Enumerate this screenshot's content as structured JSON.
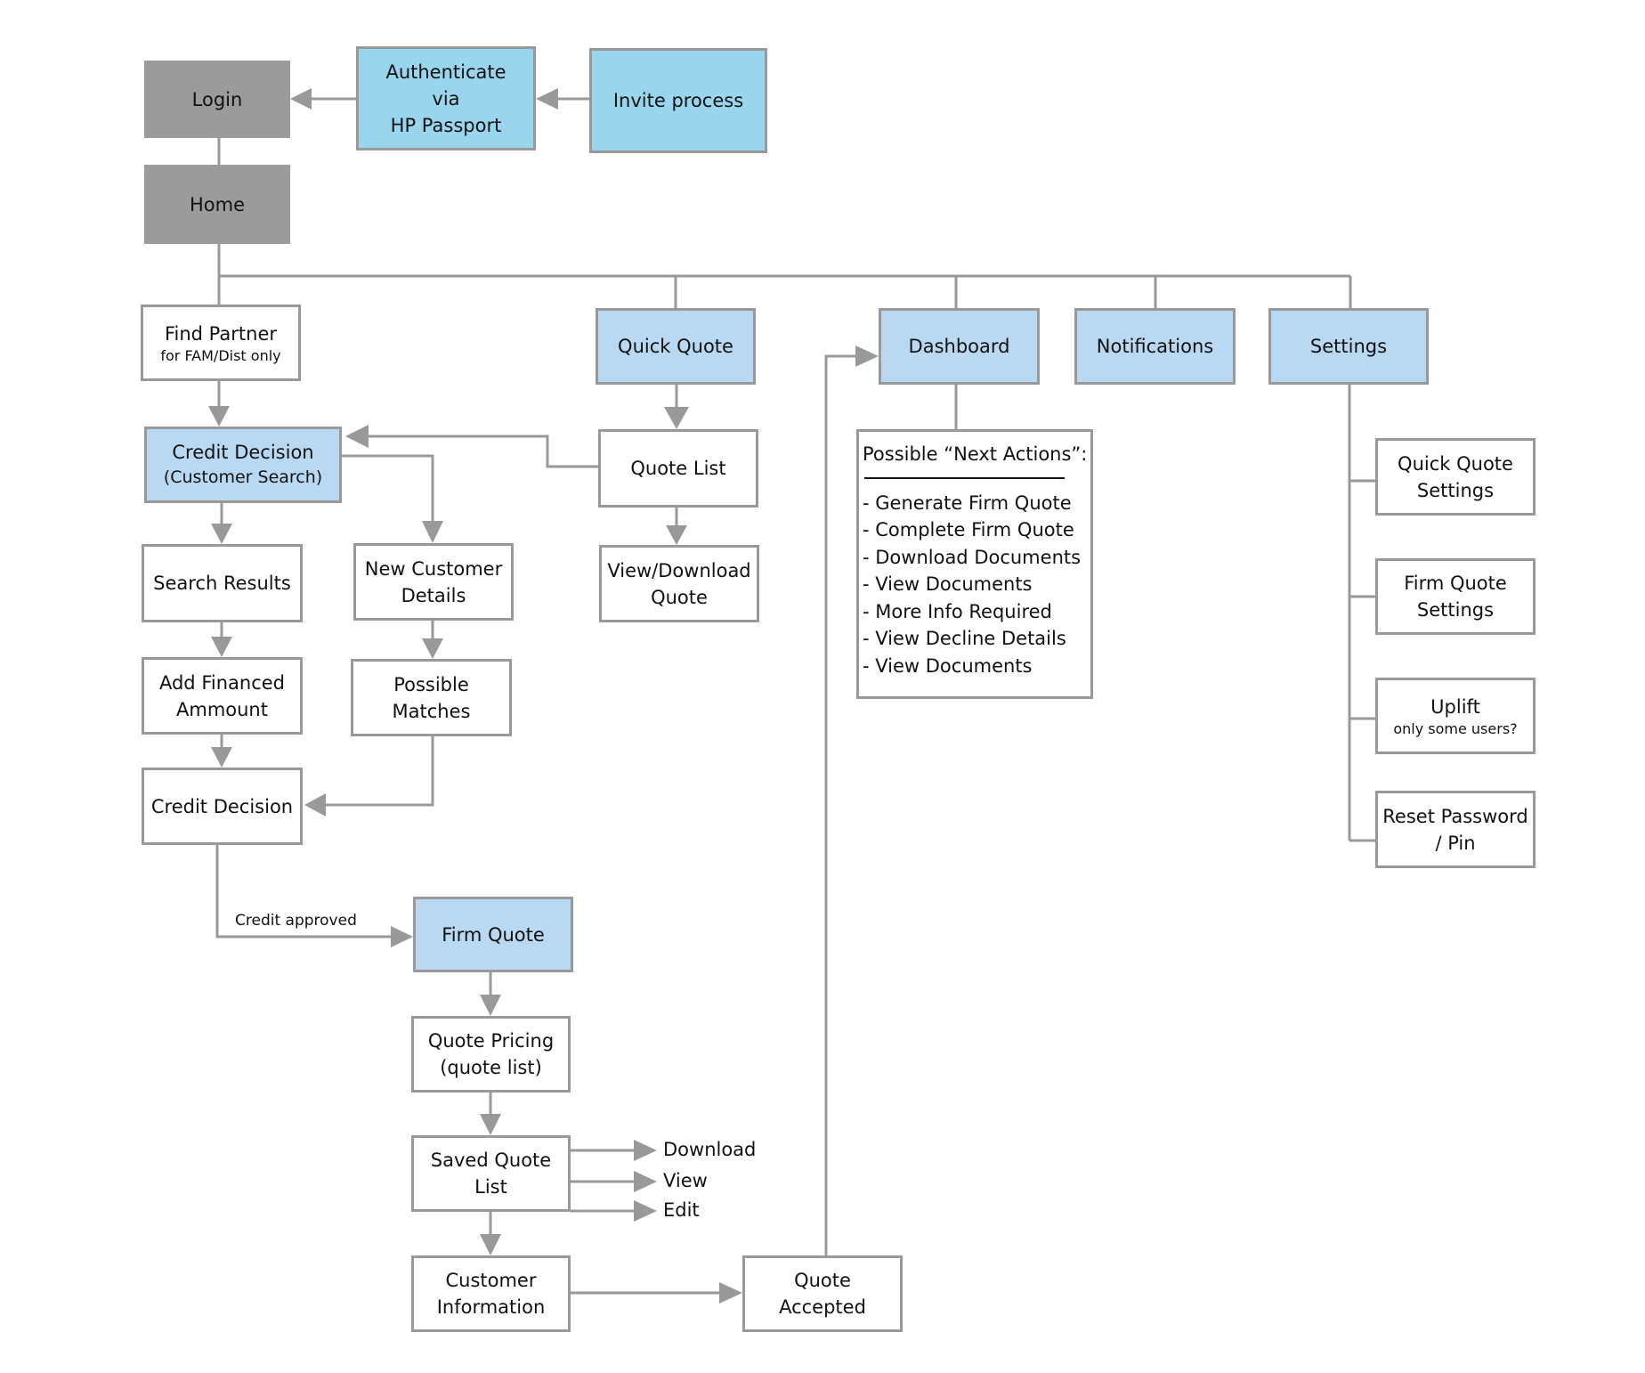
{
  "colors": {
    "line": "#999999",
    "gray_box": "#9b9b9b",
    "cyan_box": "#99d6ee",
    "blue_box": "#b9d9f2"
  },
  "nodes": {
    "login": "Login",
    "authenticate": [
      "Authenticate",
      "via",
      "HP Passport"
    ],
    "invite": "Invite process",
    "home": "Home",
    "find_partner": {
      "label": "Find Partner",
      "sub": "for FAM/Dist only"
    },
    "quick_quote": "Quick Quote",
    "dashboard": "Dashboard",
    "notifications": "Notifications",
    "settings": "Settings",
    "credit_decision_search": {
      "label": "Credit Decision",
      "sub": "(Customer Search)"
    },
    "quote_list": "Quote List",
    "view_download": [
      "View/Download",
      "Quote"
    ],
    "search_results": "Search Results",
    "new_customer": [
      "New Customer",
      "Details"
    ],
    "add_financed": [
      "Add Financed",
      "Ammount"
    ],
    "possible_matches": [
      "Possible",
      "Matches"
    ],
    "credit_decision": "Credit Decision",
    "firm_quote": "Firm Quote",
    "quote_pricing": [
      "Quote Pricing",
      "(quote list)"
    ],
    "saved_quote_list": [
      "Saved Quote",
      "List"
    ],
    "customer_information": [
      "Customer",
      "Information"
    ],
    "quote_accepted": [
      "Quote",
      "Accepted"
    ],
    "quick_quote_settings": [
      "Quick Quote",
      "Settings"
    ],
    "firm_quote_settings": [
      "Firm Quote",
      "Settings"
    ],
    "uplift": {
      "label": "Uplift",
      "sub": "only some users?"
    },
    "reset_password": [
      "Reset Password",
      "/ Pin"
    ]
  },
  "next_actions": {
    "title": "Possible “Next Actions”:",
    "items": [
      "- Generate Firm Quote",
      "- Complete Firm Quote",
      "- Download Documents",
      "- View Documents",
      "- More Info Required",
      "- View Decline Details",
      "- View Documents"
    ]
  },
  "edge_labels": {
    "credit_approved": "Credit approved",
    "download": "Download",
    "view": "View",
    "edit": "Edit"
  }
}
